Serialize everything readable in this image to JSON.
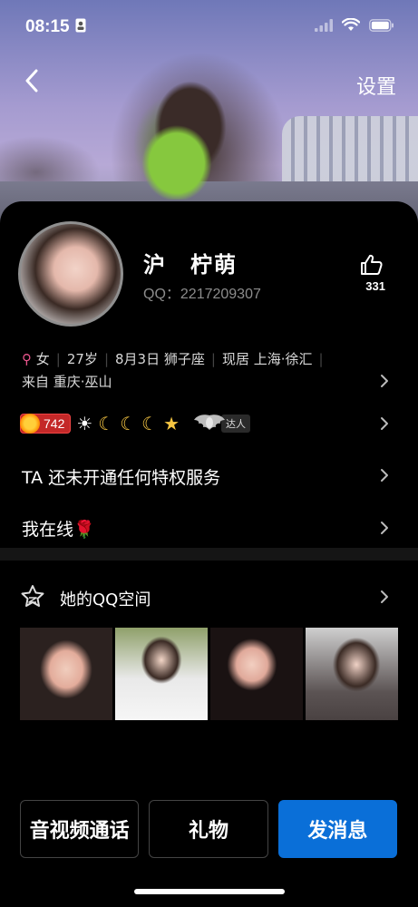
{
  "status_bar": {
    "time": "08:15"
  },
  "nav": {
    "settings_label": "设置"
  },
  "profile": {
    "name": "沪　柠萌",
    "qq": "QQ：2217209307",
    "like_count": "331"
  },
  "info": {
    "gender": "女",
    "age": "27岁",
    "birthday": "8月3日 狮子座",
    "residence": "现居 上海·徐汇",
    "hometown": "来自 重庆·巫山"
  },
  "level": {
    "value": "742",
    "talent_label": "达人"
  },
  "rows": {
    "privilege": "TA 还未开通任何特权服务",
    "online": "我在线🌹"
  },
  "qzone": {
    "title": "她的QQ空间"
  },
  "actions": {
    "call": "音视频通话",
    "gift": "礼物",
    "message": "发消息"
  },
  "colors": {
    "primary": "#0a6fd8",
    "level_badge": "#c42828",
    "female": "#e9558c"
  }
}
